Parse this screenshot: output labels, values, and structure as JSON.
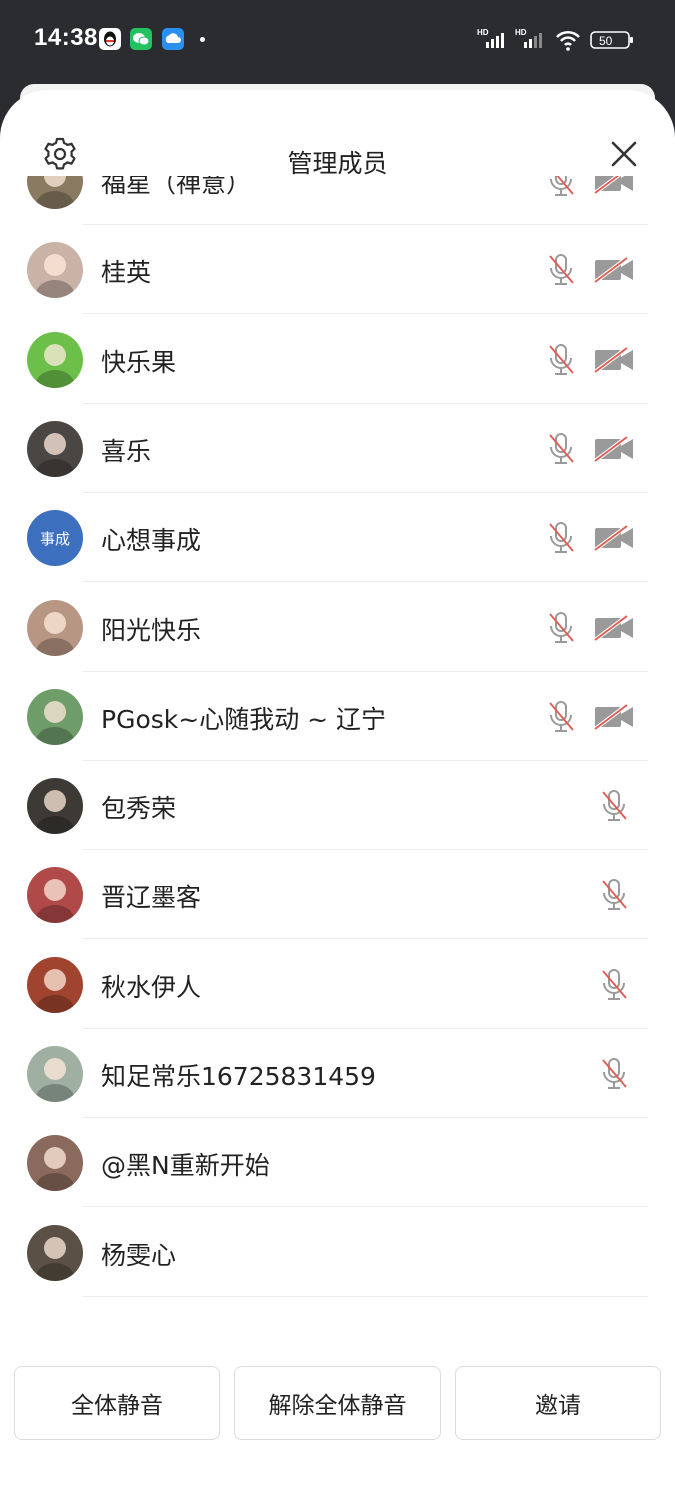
{
  "status_bar": {
    "time": "14:38",
    "apps": [
      "qq-icon",
      "wechat-icon",
      "cloud-app-icon"
    ],
    "network_label_1": "HD",
    "network_label_2": "HD",
    "battery": "50"
  },
  "header": {
    "title": "管理成员",
    "settings_icon": "gear-icon",
    "close_icon": "close-icon"
  },
  "members": [
    {
      "name": "福星（禅意）",
      "avatar_text": "",
      "mic_muted": true,
      "camera_off": true,
      "avatar_color": "#8a7a62"
    },
    {
      "name": "桂英",
      "avatar_text": "",
      "mic_muted": true,
      "camera_off": true,
      "avatar_color": "#c9b2a6"
    },
    {
      "name": "快乐果",
      "avatar_text": "",
      "mic_muted": true,
      "camera_off": true,
      "avatar_color": "#6cc04a"
    },
    {
      "name": "喜乐",
      "avatar_text": "",
      "mic_muted": true,
      "camera_off": true,
      "avatar_color": "#4a4643"
    },
    {
      "name": "心想事成",
      "avatar_text": "事成",
      "mic_muted": true,
      "camera_off": true,
      "avatar_color": "#3c6fbe"
    },
    {
      "name": "阳光快乐",
      "avatar_text": "",
      "mic_muted": true,
      "camera_off": true,
      "avatar_color": "#b89684"
    },
    {
      "name": "PGosk~心随我动 ~ 辽宁",
      "avatar_text": "",
      "mic_muted": true,
      "camera_off": true,
      "avatar_color": "#6f9d6a"
    },
    {
      "name": "包秀荣",
      "avatar_text": "",
      "mic_muted": true,
      "camera_off": false,
      "avatar_color": "#3d3a35"
    },
    {
      "name": "晋辽墨客",
      "avatar_text": "",
      "mic_muted": true,
      "camera_off": false,
      "avatar_color": "#b04a48"
    },
    {
      "name": "秋水伊人",
      "avatar_text": "",
      "mic_muted": true,
      "camera_off": false,
      "avatar_color": "#a0442f"
    },
    {
      "name": "知足常乐16725831459",
      "avatar_text": "",
      "mic_muted": true,
      "camera_off": false,
      "avatar_color": "#9fb0a2"
    },
    {
      "name": "@黑N重新开始",
      "avatar_text": "",
      "mic_muted": false,
      "camera_off": false,
      "avatar_color": "#8a6a5d"
    },
    {
      "name": "杨雯心",
      "avatar_text": "",
      "mic_muted": false,
      "camera_off": false,
      "avatar_color": "#5a5045"
    }
  ],
  "bottom_buttons": {
    "mute_all": "全体静音",
    "unmute_all": "解除全体静音",
    "invite": "邀请"
  },
  "colors": {
    "mute_slash": "#e05a4f",
    "icon_gray": "#9a9a9a",
    "avatar_blue": "#3c6fbe"
  }
}
